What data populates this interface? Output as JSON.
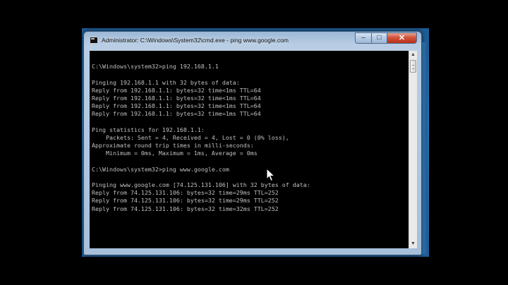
{
  "window": {
    "title": "Administrator: C:\\Windows\\System32\\cmd.exe - ping  www.google.com",
    "controls": {
      "minimize": "–",
      "maximize": "□",
      "close": "✕"
    },
    "icon": "cmd-console-icon"
  },
  "console": {
    "text_color": "#c0c0c0",
    "background": "#000000",
    "lines": [
      "",
      "C:\\Windows\\system32>ping 192.168.1.1",
      "",
      "Pinging 192.168.1.1 with 32 bytes of data:",
      "Reply from 192.168.1.1: bytes=32 time<1ms TTL=64",
      "Reply from 192.168.1.1: bytes=32 time<1ms TTL=64",
      "Reply from 192.168.1.1: bytes=32 time<1ms TTL=64",
      "Reply from 192.168.1.1: bytes=32 time=1ms TTL=64",
      "",
      "Ping statistics for 192.168.1.1:",
      "    Packets: Sent = 4, Received = 4, Lost = 0 (0% loss),",
      "Approximate round trip times in milli-seconds:",
      "    Minimum = 0ms, Maximum = 1ms, Average = 0ms",
      "",
      "C:\\Windows\\system32>ping www.google.com",
      "",
      "Pinging www.google.com [74.125.131.106] with 32 bytes of data:",
      "Reply from 74.125.131.106: bytes=32 time=29ms TTL=252",
      "Reply from 74.125.131.106: bytes=32 time=29ms TTL=252",
      "Reply from 74.125.131.106: bytes=32 time=32ms TTL=252"
    ]
  },
  "scrollbar": {
    "up_arrow": "▲",
    "down_arrow": "▼"
  }
}
